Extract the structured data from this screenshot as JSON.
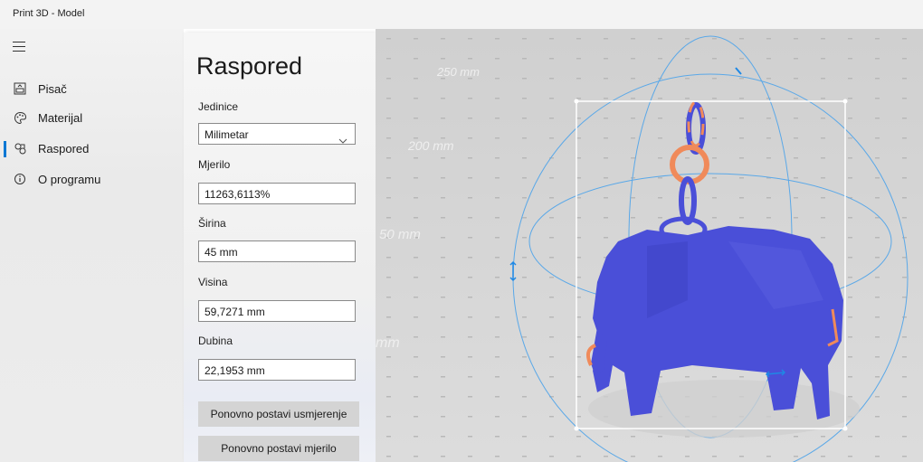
{
  "window": {
    "title": "Print 3D - Model"
  },
  "nav": {
    "items": [
      {
        "label": "Pisač",
        "icon": "printer-icon"
      },
      {
        "label": "Materijal",
        "icon": "palette-icon"
      },
      {
        "label": "Raspored",
        "icon": "layout-icon",
        "active": true
      },
      {
        "label": "O programu",
        "icon": "info-icon"
      }
    ]
  },
  "panel": {
    "title": "Raspored",
    "units_label": "Jedinice",
    "units_value": "Milimetar",
    "scale_label": "Mjerilo",
    "scale_value": "11263,6113%",
    "width_label": "Širina",
    "width_value": "45 mm",
    "height_label": "Visina",
    "height_value": "59,7271 mm",
    "depth_label": "Dubina",
    "depth_value": "22,1953 mm",
    "reset_orientation": "Ponovno postavi usmjerenje",
    "reset_scale": "Ponovno postavi mjerilo"
  },
  "viewport": {
    "labels": [
      "250 mm",
      "200 mm",
      "50 mm",
      "mm"
    ]
  },
  "colors": {
    "accent": "#0078d4",
    "model": "#4a4fd8",
    "highlight": "#f08a5a",
    "gizmo": "#5aa8e8"
  }
}
